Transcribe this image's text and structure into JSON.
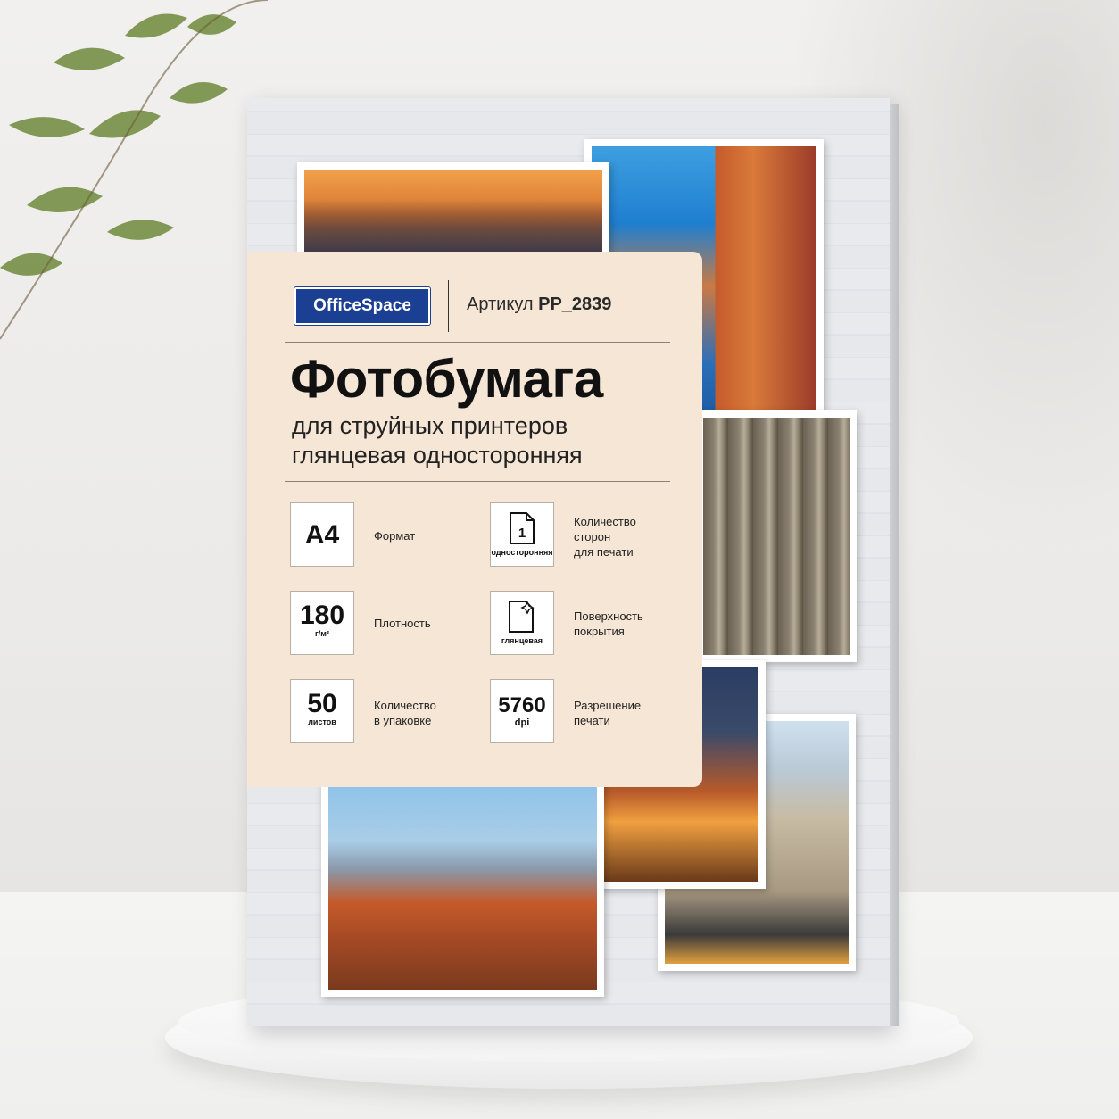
{
  "product": {
    "brand": "OfficeSpace",
    "article_label": "Артикул",
    "article_number": "PP_2839",
    "title": "Фотобумага",
    "subtitle_line1": "для струйных принтеров",
    "subtitle_line2": "глянцевая односторонняя"
  },
  "specs": {
    "format": {
      "value": "A4",
      "label": "Формат"
    },
    "density": {
      "value": "180",
      "unit": "г/м²",
      "label": "Плотность"
    },
    "quantity": {
      "value": "50",
      "unit": "листов",
      "label_line1": "Количество",
      "label_line2": "в упаковке"
    },
    "sides": {
      "icon_number": "1",
      "caption": "односторонняя",
      "label_line1": "Количество",
      "label_line2": "сторон",
      "label_line3": "для печати"
    },
    "surface": {
      "caption": "глянцевая",
      "label_line1": "Поверхность",
      "label_line2": "покрытия"
    },
    "resolution": {
      "value": "5760",
      "unit": "dpi",
      "label_line1": "Разрешение",
      "label_line2": "печати"
    }
  },
  "colors": {
    "brand_blue": "#1b3f93",
    "label_panel": "#f5e6d6",
    "box_wood": "#e7e8ec"
  }
}
